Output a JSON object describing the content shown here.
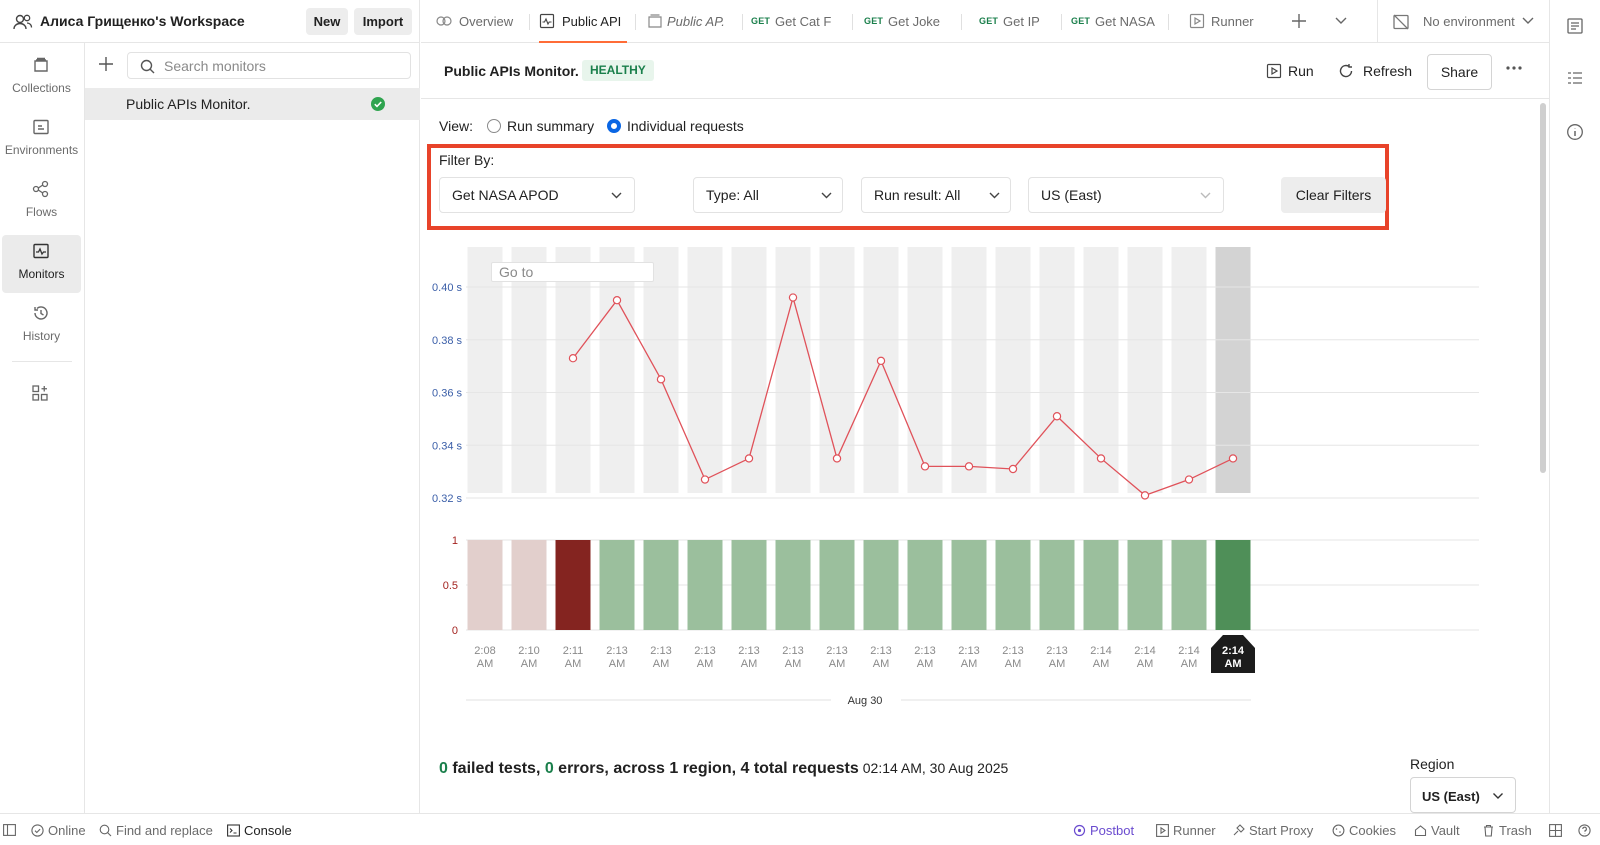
{
  "workspace": {
    "title": "Алиса Грищенко's Workspace",
    "new_label": "New",
    "import_label": "Import"
  },
  "rail": {
    "items": [
      {
        "label": "Collections",
        "icon": "collections-icon"
      },
      {
        "label": "Environments",
        "icon": "environments-icon"
      },
      {
        "label": "Flows",
        "icon": "flows-icon"
      },
      {
        "label": "Monitors",
        "icon": "monitors-icon"
      },
      {
        "label": "History",
        "icon": "history-icon"
      }
    ]
  },
  "sidebar": {
    "search_placeholder": "Search monitors",
    "monitor_name": "Public APIs Monitor."
  },
  "tabs": {
    "items": [
      {
        "label": "Overview"
      },
      {
        "label": "Public API"
      },
      {
        "label": "Public AP."
      },
      {
        "method": "GET",
        "label": "Get Cat F"
      },
      {
        "method": "GET",
        "label": "Get Joke"
      },
      {
        "method": "GET",
        "label": "Get IP"
      },
      {
        "method": "GET",
        "label": "Get NASA"
      },
      {
        "label": "Runner"
      }
    ],
    "environment": "No environment"
  },
  "monitor": {
    "title": "Public APIs Monitor.",
    "status": "HEALTHY",
    "run_label": "Run",
    "refresh_label": "Refresh",
    "share_label": "Share"
  },
  "view": {
    "label": "View:",
    "options": [
      "Run summary",
      "Individual requests"
    ],
    "selected": "Individual requests"
  },
  "filters": {
    "label": "Filter By:",
    "request": "Get NASA APOD",
    "type": "Type: All",
    "run_result": "Run result: All",
    "region": "US (East)",
    "clear_label": "Clear Filters"
  },
  "goto_placeholder": "Go to",
  "chart_data": {
    "type": "line",
    "date_label": "Aug 30",
    "x": [
      "2:08 AM",
      "2:10 AM",
      "2:11 AM",
      "2:13 AM",
      "2:13 AM",
      "2:13 AM",
      "2:13 AM",
      "2:13 AM",
      "2:13 AM",
      "2:13 AM",
      "2:13 AM",
      "2:13 AM",
      "2:13 AM",
      "2:13 AM",
      "2:14 AM",
      "2:14 AM",
      "2:14 AM",
      "2:14 AM"
    ],
    "selected_index": 17,
    "response_time": {
      "y_ticks": [
        "0.40 s",
        "0.38 s",
        "0.36 s",
        "0.34 s",
        "0.32 s"
      ],
      "ylim": [
        0.32,
        0.4
      ],
      "values": [
        null,
        null,
        0.373,
        0.395,
        0.365,
        0.327,
        0.335,
        0.396,
        0.335,
        0.372,
        0.332,
        0.332,
        0.331,
        0.351,
        0.335,
        0.321,
        0.327,
        0.335
      ]
    },
    "results": {
      "y_ticks": [
        "1",
        "0.5",
        "0"
      ],
      "ylim": [
        0,
        1
      ],
      "values": [
        1,
        1,
        1,
        1,
        1,
        1,
        1,
        1,
        1,
        1,
        1,
        1,
        1,
        1,
        1,
        1,
        1,
        1
      ],
      "status": [
        "error",
        "error",
        "failed",
        "passed",
        "passed",
        "passed",
        "passed",
        "passed",
        "passed",
        "passed",
        "passed",
        "passed",
        "passed",
        "passed",
        "passed",
        "passed",
        "passed",
        "passed"
      ]
    },
    "colors": {
      "line": "#e0525a",
      "pass": "#9bbf9d",
      "pass_selected": "#4f8f58",
      "fail": "#842420",
      "error": "#e2cfcc",
      "column": "#efefef",
      "column_selected": "#d3d3d3"
    }
  },
  "summary": {
    "failed_count": "0",
    "failed_text": " failed tests, ",
    "errors_count": "0",
    "errors_text": " errors, across 1 region, 4 total requests",
    "timestamp": "02:14 AM, 30 Aug 2025",
    "region_label": "Region",
    "region_value": "US (East)"
  },
  "statusbar": {
    "online": "Online",
    "find": "Find and replace",
    "console": "Console",
    "postbot": "Postbot",
    "runner": "Runner",
    "proxy": "Start Proxy",
    "cookies": "Cookies",
    "vault": "Vault",
    "trash": "Trash"
  }
}
